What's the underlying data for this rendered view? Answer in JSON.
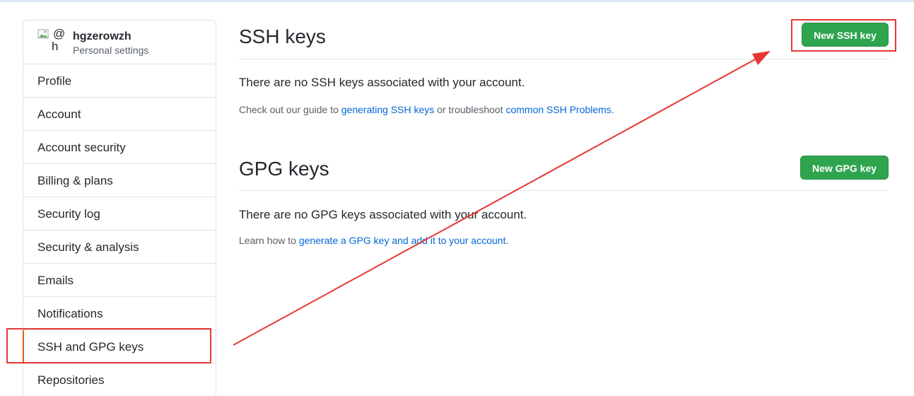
{
  "sidebar": {
    "username": "hgzerowzh",
    "subtitle": "Personal settings",
    "avatar_alt_glyph": "@",
    "avatar_alt_initial": "h",
    "items": [
      {
        "label": "Profile"
      },
      {
        "label": "Account"
      },
      {
        "label": "Account security"
      },
      {
        "label": "Billing & plans"
      },
      {
        "label": "Security log"
      },
      {
        "label": "Security & analysis"
      },
      {
        "label": "Emails"
      },
      {
        "label": "Notifications"
      },
      {
        "label": "SSH and GPG keys",
        "selected": true
      },
      {
        "label": "Repositories"
      }
    ]
  },
  "ssh": {
    "title": "SSH keys",
    "button": "New SSH key",
    "empty_message": "There are no SSH keys associated with your account.",
    "guide_prefix": "Check out our guide to ",
    "guide_link1": "generating SSH keys",
    "guide_middle": " or troubleshoot ",
    "guide_link2": "common SSH Problems",
    "guide_suffix": "."
  },
  "gpg": {
    "title": "GPG keys",
    "button": "New GPG key",
    "empty_message": "There are no GPG keys associated with your account.",
    "learn_prefix": "Learn how to ",
    "learn_link": "generate a GPG key and add it to your account",
    "learn_suffix": "."
  },
  "colors": {
    "primary_button": "#2ea44f",
    "link": "#0366d6",
    "annotation": "#e53935",
    "selected_marker": "#e36209"
  }
}
